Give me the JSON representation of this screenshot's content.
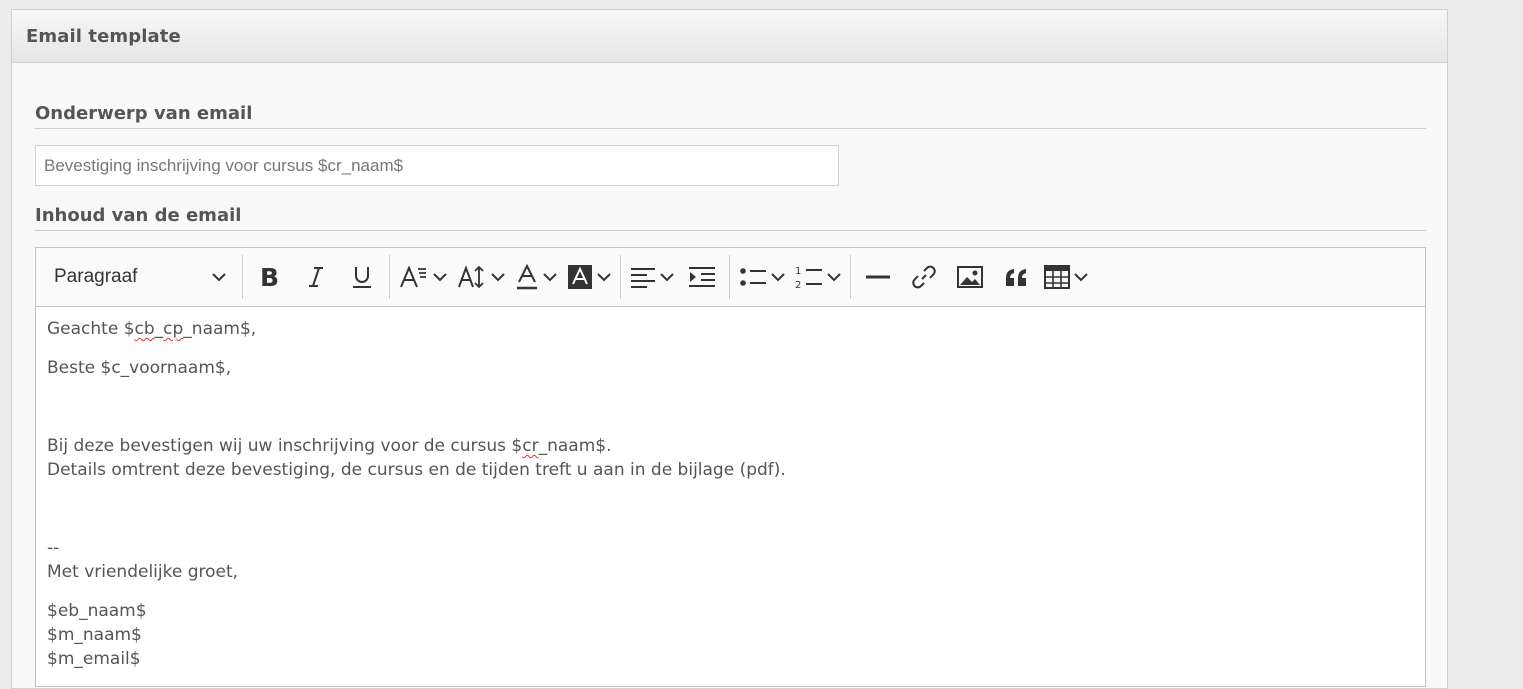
{
  "panel": {
    "title": "Email template"
  },
  "subject": {
    "label": "Onderwerp van email",
    "value": "Bevestiging inschrijving voor cursus $cr_naam$"
  },
  "body_section": {
    "label": "Inhoud van de email"
  },
  "toolbar": {
    "heading_select": "Paragraaf",
    "buttons": [
      "bold-icon",
      "italic-icon",
      "underline-icon",
      "font-family-icon",
      "font-size-icon",
      "font-color-icon",
      "font-background-icon",
      "alignment-icon",
      "indent-icon",
      "bulleted-list-icon",
      "numbered-list-icon",
      "horizontal-line-icon",
      "link-icon",
      "image-icon",
      "blockquote-icon",
      "table-icon"
    ]
  },
  "content": {
    "greeting1_prefix": "Geachte $",
    "greeting1_err1": "cb",
    "greeting1_gap1": "_",
    "greeting1_err2": "cp",
    "greeting1_suffix": "_naam$,",
    "greeting2": "Beste $c_voornaam$,",
    "para1_prefix": "Bij deze bevestigen wij uw inschrijving voor de cursus $",
    "para1_err": "cr",
    "para1_suffix": "_naam$.",
    "para2": "Details omtrent deze bevestiging, de cursus en de tijden treft u aan in de bijlage (pdf).",
    "sig_dash": "--",
    "closing": "Met vriendelijke groet,",
    "sig_line1": "$eb_naam$",
    "sig_line2": "$m_naam$",
    "sig_line3": "$m_email$"
  }
}
